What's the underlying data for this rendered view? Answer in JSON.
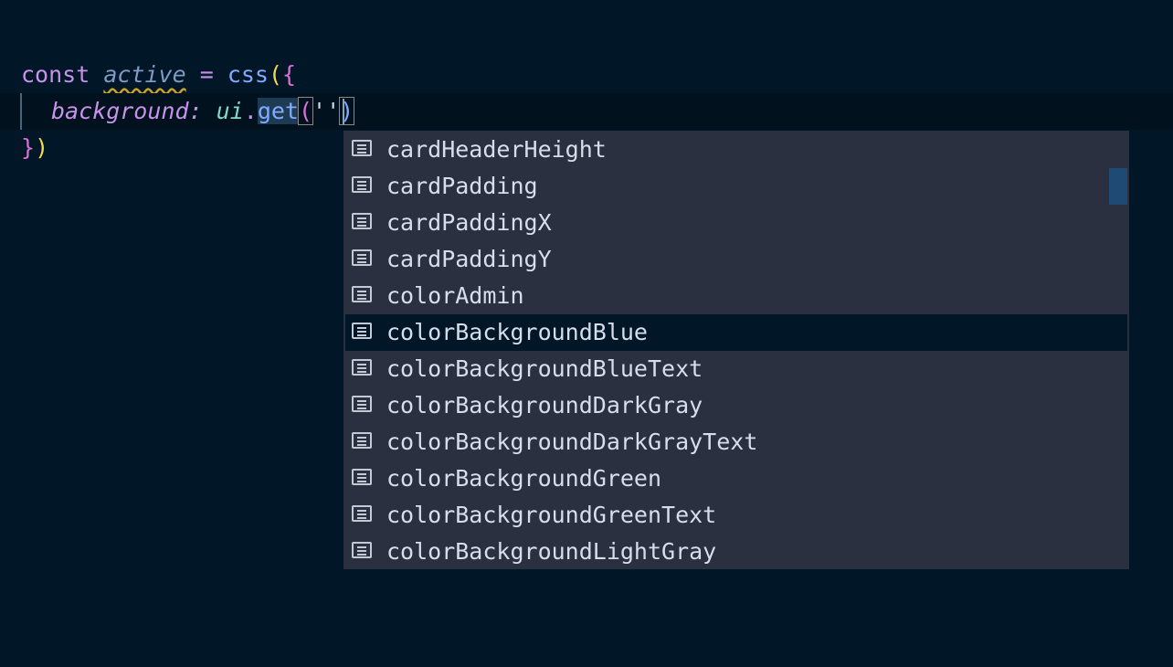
{
  "editor": {
    "line1": {
      "keyword": "const",
      "variable": "active",
      "operator": "=",
      "call": "css",
      "open_paren": "(",
      "open_brace": "{"
    },
    "line2": {
      "property": "background",
      "colon": ":",
      "object": "ui",
      "dot": ".",
      "method": "get",
      "open_paren": "(",
      "string": "''",
      "close_paren": ")"
    },
    "line3": {
      "close_brace": "}",
      "close_paren": ")"
    }
  },
  "suggestions": {
    "selected_index": 5,
    "items": [
      {
        "label": "cardHeaderHeight",
        "icon": "value-icon"
      },
      {
        "label": "cardPadding",
        "icon": "value-icon"
      },
      {
        "label": "cardPaddingX",
        "icon": "value-icon"
      },
      {
        "label": "cardPaddingY",
        "icon": "value-icon"
      },
      {
        "label": "colorAdmin",
        "icon": "value-icon"
      },
      {
        "label": "colorBackgroundBlue",
        "icon": "value-icon"
      },
      {
        "label": "colorBackgroundBlueText",
        "icon": "value-icon"
      },
      {
        "label": "colorBackgroundDarkGray",
        "icon": "value-icon"
      },
      {
        "label": "colorBackgroundDarkGrayText",
        "icon": "value-icon"
      },
      {
        "label": "colorBackgroundGreen",
        "icon": "value-icon"
      },
      {
        "label": "colorBackgroundGreenText",
        "icon": "value-icon"
      },
      {
        "label": "colorBackgroundLightGray",
        "icon": "value-icon"
      }
    ]
  },
  "colors": {
    "editor_background": "#011627",
    "suggest_background": "#2b3040",
    "selected_item_background": "#011627",
    "scrollbar": "#1f4a73"
  }
}
